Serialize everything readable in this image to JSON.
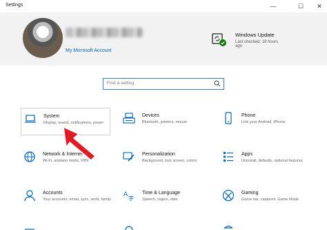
{
  "window": {
    "title": "Settings"
  },
  "controls": {
    "minimize": "—",
    "maximize": "☐",
    "close": "✕"
  },
  "account": {
    "link": "My Microsoft Account"
  },
  "update": {
    "title": "Windows Update",
    "status": "Last checked: 18 hours",
    "age": "ago"
  },
  "search": {
    "placeholder": "Find a setting"
  },
  "tiles": [
    {
      "name": "System",
      "desc": "Display, sound, notifications, power",
      "icon": "laptop-icon"
    },
    {
      "name": "Devices",
      "desc": "Bluetooth, printers, mouse",
      "icon": "keyboard-icon"
    },
    {
      "name": "Phone",
      "desc": "Link your Android, iPhone",
      "icon": "phone-icon"
    },
    {
      "name": "Network & Internet",
      "desc": "Wi-Fi, airplane mode, VPN",
      "icon": "globe-icon"
    },
    {
      "name": "Personalization",
      "desc": "Background, lock screen, colors",
      "icon": "brush-icon"
    },
    {
      "name": "Apps",
      "desc": "Uninstall, defaults, optional features",
      "icon": "apps-icon"
    },
    {
      "name": "Accounts",
      "desc": "Your accounts, email, sync, work, family",
      "icon": "person-icon"
    },
    {
      "name": "Time & Language",
      "desc": "Speech, region, date",
      "icon": "language-icon"
    },
    {
      "name": "Gaming",
      "desc": "Game bar, captures, Game Mode",
      "icon": "xbox-icon"
    }
  ],
  "colors": {
    "accent": "#0063b1",
    "annotation": "#e01b24",
    "header_bg": "#f2f2f2"
  }
}
